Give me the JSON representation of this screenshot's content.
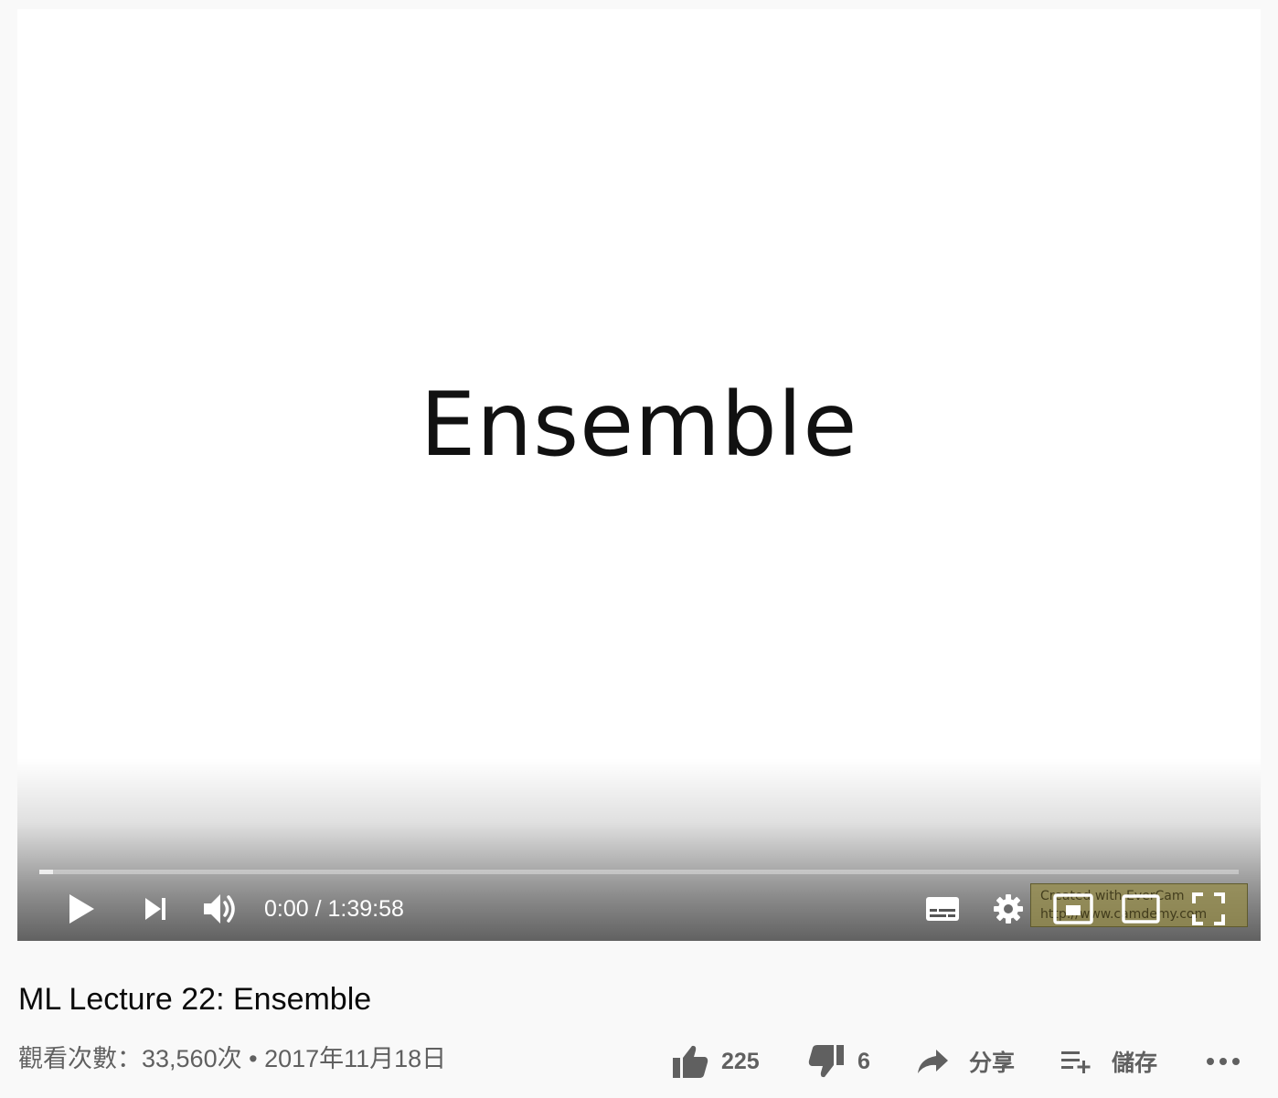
{
  "player": {
    "slide_title": "Ensemble",
    "current_time": "0:00",
    "separator": " / ",
    "duration": "1:39:58",
    "progress_fraction": 0,
    "watermark": {
      "line1": "Created with EverCam",
      "line2": "http://www.camdemy.com"
    },
    "icons": {
      "play": "play-icon",
      "next": "next-icon",
      "volume": "volume-icon",
      "subtitles": "subtitles-icon",
      "settings": "gear-icon",
      "miniplayer": "miniplayer-icon",
      "theater": "theater-mode-icon",
      "fullscreen": "fullscreen-icon"
    }
  },
  "video": {
    "title": "ML Lecture 22: Ensemble",
    "views": "觀看次數：33,560次",
    "date_separator": " • ",
    "date": "2017年11月18日"
  },
  "actions": {
    "like_count": "225",
    "dislike_count": "6",
    "share_label": "分享",
    "save_label": "儲存",
    "more_icon": "more-horizontal-icon"
  },
  "colors": {
    "page_bg": "#f9f9f9",
    "icon_gray": "#606060",
    "progress_played": "#ff0000"
  }
}
